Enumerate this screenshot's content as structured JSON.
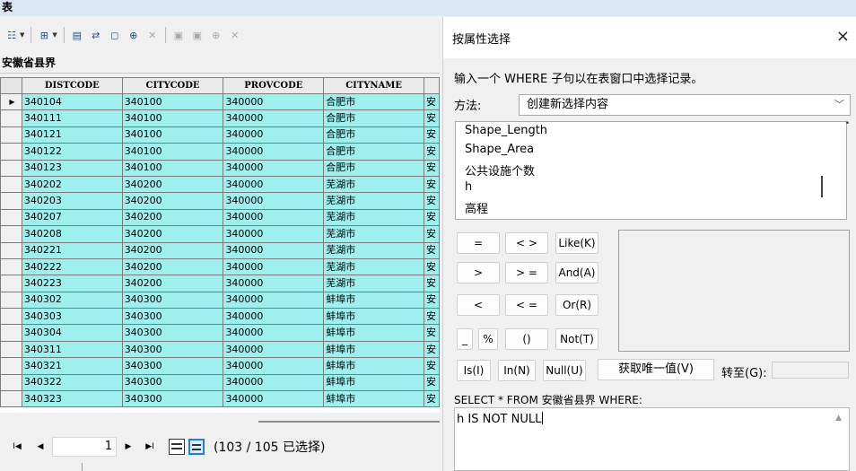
{
  "window": {
    "title": "表"
  },
  "layer_name": "安徽省县界",
  "table": {
    "columns": [
      "DISTCODE",
      "CITYCODE",
      "PROVCODE",
      "CITYNAME",
      ""
    ],
    "rows": [
      [
        "340104",
        "340100",
        "340000",
        "合肥市",
        "安"
      ],
      [
        "340111",
        "340100",
        "340000",
        "合肥市",
        "安"
      ],
      [
        "340121",
        "340100",
        "340000",
        "合肥市",
        "安"
      ],
      [
        "340122",
        "340100",
        "340000",
        "合肥市",
        "安"
      ],
      [
        "340123",
        "340100",
        "340000",
        "合肥市",
        "安"
      ],
      [
        "340202",
        "340200",
        "340000",
        "芜湖市",
        "安"
      ],
      [
        "340203",
        "340200",
        "340000",
        "芜湖市",
        "安"
      ],
      [
        "340207",
        "340200",
        "340000",
        "芜湖市",
        "安"
      ],
      [
        "340208",
        "340200",
        "340000",
        "芜湖市",
        "安"
      ],
      [
        "340221",
        "340200",
        "340000",
        "芜湖市",
        "安"
      ],
      [
        "340222",
        "340200",
        "340000",
        "芜湖市",
        "安"
      ],
      [
        "340223",
        "340200",
        "340000",
        "芜湖市",
        "安"
      ],
      [
        "340302",
        "340300",
        "340000",
        "蚌埠市",
        "安"
      ],
      [
        "340303",
        "340300",
        "340000",
        "蚌埠市",
        "安"
      ],
      [
        "340304",
        "340300",
        "340000",
        "蚌埠市",
        "安"
      ],
      [
        "340311",
        "340300",
        "340000",
        "蚌埠市",
        "安"
      ],
      [
        "340321",
        "340300",
        "340000",
        "蚌埠市",
        "安"
      ],
      [
        "340322",
        "340300",
        "340000",
        "蚌埠市",
        "安"
      ],
      [
        "340323",
        "340300",
        "340000",
        "蚌埠市",
        "安"
      ]
    ],
    "current_row_marker": "▶"
  },
  "navigation": {
    "first": "I◀",
    "prev": "◀",
    "current_page": "1",
    "next": "▶",
    "last": "▶I",
    "status": "(103 / 105 已选择)"
  },
  "dialog": {
    "title": "按属性选择",
    "close": "×",
    "instruction": "输入一个 WHERE 子句以在表窗口中选择记录。",
    "method_label": "方法:",
    "method_value": "创建新选择内容",
    "method_chevron": "﹀",
    "fields": [
      "Shape_Length",
      "Shape_Area",
      "公共设施个数",
      "h",
      "高程"
    ],
    "operators": {
      "eq": "=",
      "ne": "< >",
      "like": "Like(K)",
      "gt": ">",
      "ge": "> =",
      "and": "And(A)",
      "lt": "<",
      "le": "< =",
      "or": "Or(R)",
      "underscore": "_",
      "percent": "%",
      "parens": "()",
      "not": "Not(T)",
      "is": "Is(I)",
      "in": "In(N)",
      "null": "Null(U)"
    },
    "unique_values_button": "获取唯一值(V)",
    "goto_label": "转至(G):",
    "sql_prefix": "SELECT * FROM 安徽省县界 WHERE:",
    "sql_text": "h IS NOT NULL"
  },
  "colors": {
    "selected_row": "#9ef0ef",
    "title_bar": "#dbe6f4"
  }
}
